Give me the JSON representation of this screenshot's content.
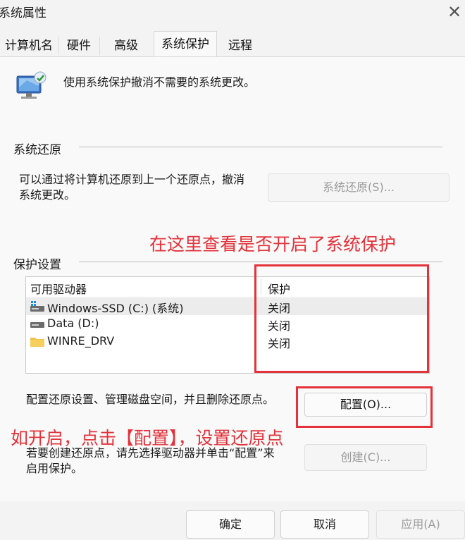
{
  "window": {
    "title": "系统属性",
    "close_glyph": "✕"
  },
  "tabs": [
    {
      "label": "计算机名"
    },
    {
      "label": "硬件"
    },
    {
      "label": "高级"
    },
    {
      "label": "系统保护",
      "active": true
    },
    {
      "label": "远程"
    }
  ],
  "intro_text": "使用系统保护撤消不需要的系统更改。",
  "restore": {
    "group_title": "系统还原",
    "desc_line1": "可以通过将计算机还原到上一个还原点，撤消",
    "desc_line2": "系统更改。",
    "button": "系统还原(S)..."
  },
  "protection": {
    "group_title": "保护设置",
    "col_drive": "可用驱动器",
    "col_protection": "保护",
    "drives": [
      {
        "name": "Windows-SSD (C:) (系统)",
        "status": "关闭",
        "icon": "system-drive-icon",
        "selected": true
      },
      {
        "name": "Data (D:)",
        "status": "关闭",
        "icon": "drive-icon",
        "selected": false
      },
      {
        "name": "WINRE_DRV",
        "status": "关闭",
        "icon": "folder-icon",
        "selected": false
      }
    ],
    "configure_desc": "配置还原设置、管理磁盘空间，并且删除还原点。",
    "configure_button": "配置(O)...",
    "create_desc_line1": "若要创建还原点，请先选择驱动器并单击“配置”来",
    "create_desc_line2": "启用保护。",
    "create_button": "创建(C)..."
  },
  "footer": {
    "ok": "确定",
    "cancel": "取消",
    "apply": "应用(A)"
  },
  "annotations": {
    "top": "在这里查看是否开启了系统保护",
    "bottom": "如开启，点击【配置】，设置还原点",
    "color": "#e3323a"
  }
}
